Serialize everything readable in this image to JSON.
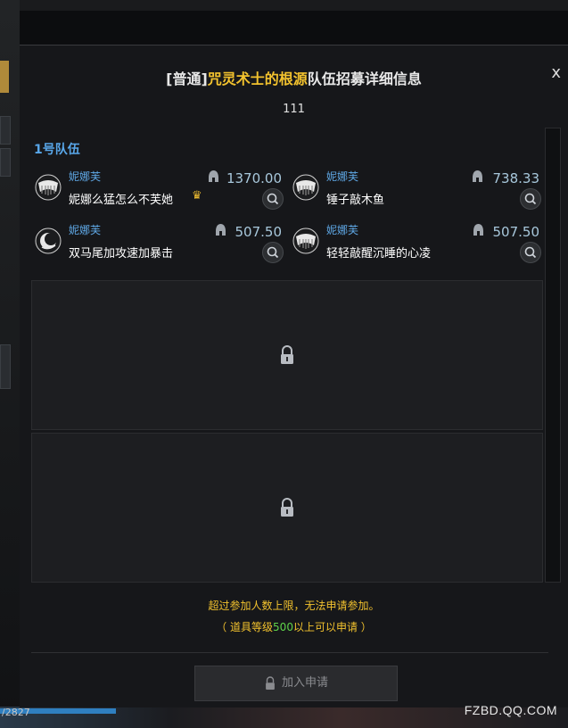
{
  "dialog": {
    "close_label": "x",
    "title_prefix": "[普通]",
    "title_highlight": "咒灵术士的根源",
    "title_suffix": "队伍招募详细信息",
    "subtitle": "111",
    "party_label": "1号队伍",
    "members": [
      {
        "class_name": "妮娜芙",
        "player_name": "妮娜么猛怎么不芙她",
        "item_level": "1370.00",
        "is_leader": true,
        "avatar_icon": "wings-class-icon"
      },
      {
        "class_name": "妮娜芙",
        "player_name": "锤子敲木鱼",
        "item_level": "738.33",
        "is_leader": false,
        "avatar_icon": "wings-class-icon"
      },
      {
        "class_name": "妮娜芙",
        "player_name": "双马尾加攻速加暴击",
        "item_level": "507.50",
        "is_leader": false,
        "avatar_icon": "moon-class-icon"
      },
      {
        "class_name": "妮娜芙",
        "player_name": "轻轻敲醒沉睡的心凌",
        "item_level": "507.50",
        "is_leader": false,
        "avatar_icon": "wings-class-icon"
      }
    ],
    "locked_slots": 2,
    "notice_line1": "超过参加人数上限，无法申请参加。",
    "notice_line2_prefix": "（ 道具等级",
    "notice_line2_number": "500",
    "notice_line2_suffix": "以上可以申请 ）",
    "join_button_label": "加入申请"
  },
  "hud": {
    "bottom_left_text": "/2827",
    "watermark": "FZBD.QQ.COM"
  },
  "colors": {
    "accent_gold": "#f2c22e",
    "class_blue": "#5fa8e6",
    "number_green": "#5fd34a",
    "panel_bg": "#16171a"
  }
}
